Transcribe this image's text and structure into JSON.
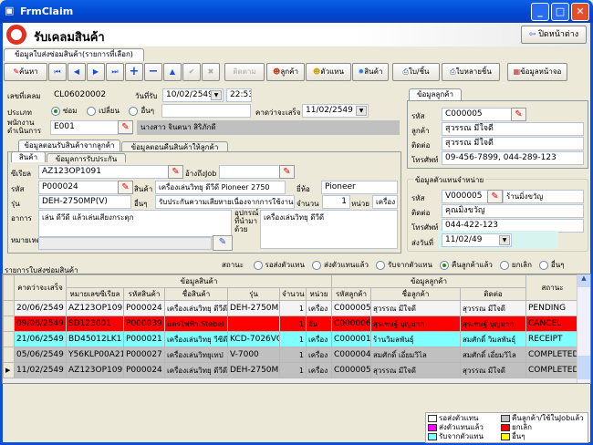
{
  "window": {
    "title": "FrmClaim",
    "min": "_",
    "max": "□",
    "close": "✕"
  },
  "header": {
    "title": "รับเคลมสินค้า",
    "close_window": "ปิดหน้าต่าง"
  },
  "main_tab": "ข้อมูลใบส่งซ่อมสินค้า(รายการที่เลือก)",
  "toolbar": {
    "search": "ค้นหา",
    "first": "⏮",
    "prev": "◀",
    "next": "▶",
    "last": "⏭",
    "add": "+",
    "remove": "−",
    "up": "▲",
    "save": "✔",
    "cancel": "✖",
    "tracking": "ติดตาม",
    "customer": "ลูกค้า",
    "dealer": "ตัวแทน",
    "product": "สินค้า",
    "print_single": "ใบ/ชิ้น",
    "print_multi": "ใบหลายชิ้น",
    "screen_info": "ข้อมูลหน้าจอ"
  },
  "form": {
    "claim_no_label": "เลขที่เคลม",
    "claim_no": "CL06020002",
    "recv_date_label": "วันที่รับ",
    "recv_date": "10/02/2549",
    "recv_time": "22:53",
    "type_label": "ประเภท",
    "type_options": [
      "ซ่อม",
      "เปลี่ยน",
      "อื่นๆ"
    ],
    "type_other": "",
    "expected_label": "คาดว่าจะเสร็จ",
    "expected_date": "11/02/2549",
    "staff_label": "พนักงานดำเนินการ",
    "staff_code": "E001",
    "staff_name": "นางสาว จินตนา สิริภักดี"
  },
  "sub_tabs": [
    "ข้อมูลตอนรับสินค้าจากลูกค้า",
    "ข้อมูลตอนคืนสินค้าให้ลูกค้า"
  ],
  "inner_tabs": [
    "สินค้า",
    "ข้อมูลการรับประกัน"
  ],
  "product": {
    "serial_label": "ซีเรียล",
    "serial": "AZ123OP1091",
    "job_ref_label": "อ้างถึงJob",
    "job_ref": "",
    "code_label": "รหัส",
    "code": "P000024",
    "name_label": "สินค้า",
    "name": "เครื่องเล่นวิทยุ ดีวีดี  Pioneer 2750",
    "brand_label": "ยี่ห้อ",
    "brand": "Pioneer",
    "model_label": "รุ่น",
    "model": "DEH-2750MP(V)",
    "other_label": "อื่นๆ",
    "other": "รับประกันความเสียหายเนื่องจากการใช้งาน",
    "qty_label": "จำนวน",
    "qty": "1",
    "unit_label": "หน่วย",
    "unit": "เครื่อง",
    "symptom_label": "อาการ",
    "symptom": "เล่น ดีวีดี แล้วเล่นเสียงกระตุก",
    "accessory_label": "อุปกรณ์ที่นำมาด้วย",
    "accessory": "เครื่องเล่นวิทยุ ดีวีดี",
    "note_label": "หมายเหตุ",
    "note": ""
  },
  "customer": {
    "tab": "ข้อมูลลูกค้า",
    "code_label": "รหัส",
    "code": "C000005",
    "name_label": "ลูกค้า",
    "name": "สุวรรณ มีใจดี",
    "contact_label": "ติดต่อ",
    "contact": "สุวรรณ มีใจดี",
    "phone_label": "โทรศัพท์",
    "phone": "09-456-7899, 044-289-123"
  },
  "dealer": {
    "title": "ข้อมูลตัวแทนจำหน่าย",
    "code_label": "รหัส",
    "code": "V000005",
    "name": "ร้านมิ่งขวัญ",
    "contact_label": "ติดต่อ",
    "contact": "คุณมิ่งขวัญ",
    "phone_label": "โทรศัพท์",
    "phone": "044-422-123",
    "send_label": "ส่งวันที่",
    "send_date": "11/02/49"
  },
  "list": {
    "link": "รายการใบส่งซ่อมสินค้า",
    "status_label": "สถานะ",
    "status_options": [
      "รอส่งตัวแทน",
      "ส่งตัวแทนแล้ว",
      "รับจากตัวแทน",
      "คืนลูกค้าแล้ว",
      "ยกเลิก",
      "อื่นๆ"
    ],
    "status_selected": 3
  },
  "grid": {
    "group_headers": {
      "product": "ข้อมูลสินค้า",
      "customer": "ข้อมูลลูกค้า"
    },
    "columns": [
      "คาดว่าจะเสร็จ",
      "หมายเลขซีเรียล",
      "รหัสสินค้า",
      "ชื่อสินค้า",
      "รุ่น",
      "จำนวน",
      "หน่วย",
      "รหัสลูกค้า",
      "ชื่อลูกค้า",
      "ติดต่อ",
      "สถานะ"
    ],
    "rows": [
      {
        "cells": [
          "20/06/2549",
          "AZ123OP1091",
          "P000024",
          "เครื่องเล่นวิทยุ ดีวีดี",
          "DEH-2750MP",
          "1",
          "เครื่อง",
          "C000005",
          "สุวรรณ มีใจดี",
          "สุวรรณ มีใจดี",
          "PENDING"
        ],
        "color": "#f4f4f4",
        "text": "#000"
      },
      {
        "cells": [
          "09/06/2549",
          "SD123001",
          "P000039",
          "แตรไฟฟ้า Stebel",
          "",
          "1",
          "อัน",
          "C000006",
          "สุรเชษฐ์ บุญมาก",
          "สุรเชษฐ์ บุญมาก",
          "CANCEL"
        ],
        "color": "#ff0000",
        "text": "#000"
      },
      {
        "cells": [
          "21/06/2549",
          "BD45012LK1",
          "P000021",
          "เครื่องเล่นวิทยุ วีซีดี",
          "KCD-7026VCI",
          "1",
          "เครื่อง",
          "C000001",
          "ร้านวิมลพันธุ์",
          "สมศักดิ์ วิมลพันธุ์",
          "RECEIPT"
        ],
        "color": "#80ffff",
        "text": "#000"
      },
      {
        "cells": [
          "05/06/2549",
          "Y56KLP00A21",
          "P000027",
          "เครื่องเล่นวิทยุเทป",
          "V-7000",
          "1",
          "เครื่อง",
          "C000004",
          "สมศักดิ์ เอี่ยมวิไล",
          "สมศักดิ์ เอี่ยมวิไล",
          "COMPLETED"
        ],
        "color": "#c0c0c0",
        "text": "#000"
      },
      {
        "cells": [
          "11/02/2549",
          "AZ123OP1091",
          "P000024",
          "เครื่องเล่นวิทยุ ดีวีดี",
          "DEH-2750MP",
          "1",
          "เครื่อง",
          "C000005",
          "สุวรรณ มีใจดี",
          "สุวรรณ มีใจดี",
          "COMPLETED"
        ],
        "color": "#c0c0c0",
        "text": "#000",
        "current": true
      }
    ]
  },
  "legend": [
    {
      "label": "รอส่งตัวแทน",
      "color": "#ffffff"
    },
    {
      "label": "คืนลูกค้า/ใช้ในJobแล้ว",
      "color": "#c0c0c0"
    },
    {
      "label": "ส่งตัวแทนแล้ว",
      "color": "#ff00ff"
    },
    {
      "label": "ยกเลิก",
      "color": "#ff0000"
    },
    {
      "label": "รับจากตัวแทน",
      "color": "#80ffff"
    },
    {
      "label": "อื่นๆ",
      "color": "#ffff00"
    }
  ]
}
